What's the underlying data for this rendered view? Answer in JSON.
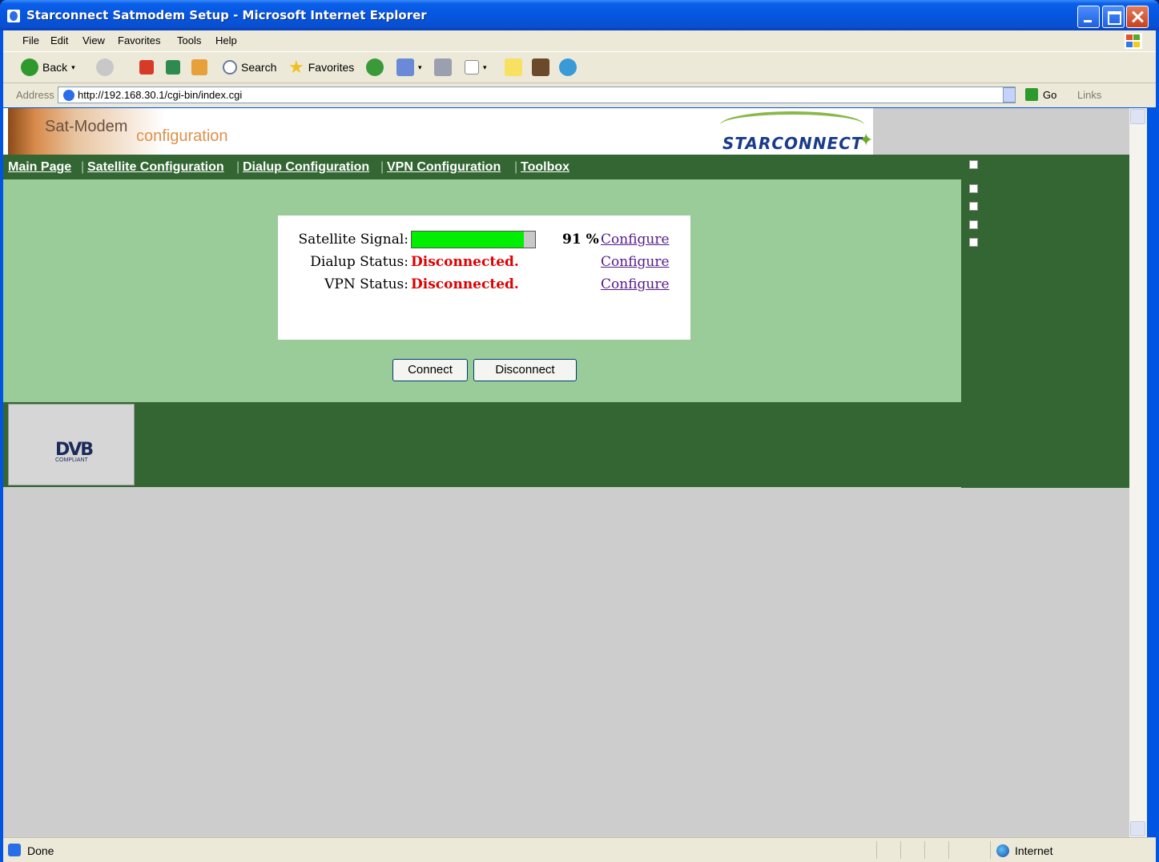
{
  "window": {
    "title": "Starconnect Satmodem Setup - Microsoft Internet Explorer"
  },
  "menu": [
    "File",
    "Edit",
    "View",
    "Favorites",
    "Tools",
    "Help"
  ],
  "toolbar": {
    "back_label": "Back",
    "search_label": "Search",
    "favorites_label": "Favorites"
  },
  "address": {
    "label": "Address",
    "url": "http://192.168.30.1/cgi-bin/index.cgi",
    "go_label": "Go",
    "links_label": "Links"
  },
  "page": {
    "header": {
      "app_name": "Sat-Modem",
      "app_sub": "configuration",
      "brand": "STARCONNECT"
    },
    "nav": [
      "Main Page",
      "Satellite Configuration",
      "Dialup Configuration",
      "VPN Configuration",
      "Toolbox"
    ],
    "status": {
      "satellite_label": "Satellite Signal:",
      "satellite_signal_percent": 91,
      "satellite_value": "91 %",
      "dialup_label": "Dialup Status:",
      "dialup_value": "Disconnected.",
      "vpn_label": "VPN Status:",
      "vpn_value": "Disconnected.",
      "configure_label": "Configure"
    },
    "buttons": {
      "connect": "Connect",
      "disconnect": "Disconnect"
    },
    "footer": {
      "dvb_logo": "DVB",
      "dvb_sub": "COMPLIANT"
    }
  },
  "statusbar": {
    "text": "Done",
    "zone": "Internet"
  },
  "colors": {
    "nav_green": "#336633",
    "content_green": "#99cc99",
    "signal_green": "#00ee00",
    "status_red": "#e00000"
  }
}
